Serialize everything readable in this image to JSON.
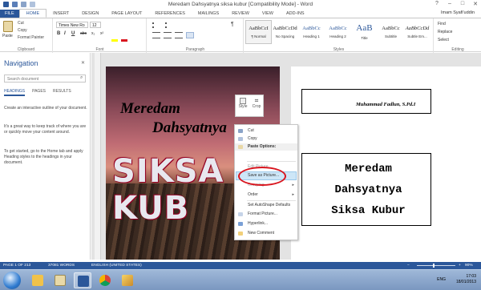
{
  "window": {
    "title": "Meredam Dahsyatnya siksa kubur [Compatibility Mode] - Word",
    "controls": [
      "?",
      "–",
      "□",
      "✕"
    ]
  },
  "ribbon_tabs": [
    "FILE",
    "HOME",
    "INSERT",
    "DESIGN",
    "PAGE LAYOUT",
    "REFERENCES",
    "MAILINGS",
    "REVIEW",
    "VIEW",
    "ADD-INS"
  ],
  "user": "Imam Syafi'uddin",
  "clipboard": {
    "paste": "Paste",
    "cut": "Cut",
    "copy": "Copy",
    "format_painter": "Format Painter",
    "label": "Clipboard"
  },
  "font": {
    "name": "Times New Ro",
    "size": "12",
    "label": "Font",
    "buttons": [
      "B",
      "I",
      "U",
      "abc",
      "x₂",
      "x²"
    ]
  },
  "paragraph": {
    "label": "Paragraph"
  },
  "styles": {
    "label": "Styles",
    "items": [
      {
        "sample": "AaBbCcI",
        "name": "¶ Normal"
      },
      {
        "sample": "AaBbCcDd",
        "name": "No Spacing"
      },
      {
        "sample": "AaBbCc",
        "name": "Heading 1"
      },
      {
        "sample": "AaBbCc",
        "name": "Heading 2"
      },
      {
        "sample": "AaB",
        "name": "Title"
      },
      {
        "sample": "AaBbCc",
        "name": "Subtitle"
      },
      {
        "sample": "AaBbCcDd",
        "name": "Subtle Em..."
      }
    ]
  },
  "editing": {
    "label": "Editing",
    "find": "Find",
    "replace": "Replace",
    "select": "Select"
  },
  "navigation": {
    "title": "Navigation",
    "close": "✕",
    "search_placeholder": "Search document",
    "tabs": [
      "HEADINGS",
      "PAGES",
      "RESULTS"
    ],
    "para1": "Create an interactive outline of your document.",
    "para2": "It's a great way to keep track of where you are or quickly move your content around.",
    "para3": "To get started, go to the Home tab and apply Heading styles to the headings in your document."
  },
  "document": {
    "cover_line1": "Meredam",
    "cover_line2": "Dahsyatnya",
    "cover_line3": "SIKSA KUB",
    "author": "Muhammad Fadlun, S.Pd.I",
    "title_line1": "Meredam",
    "title_line2": "Dahsyatnya",
    "title_line3": "Siksa Kubur"
  },
  "mini_toolbar": {
    "style": "Style",
    "crop": "Crop"
  },
  "context_menu": {
    "items": [
      {
        "label": "Cut",
        "state": "normal"
      },
      {
        "label": "Copy",
        "state": "normal"
      },
      {
        "label": "Paste Options:",
        "state": "header"
      },
      {
        "label": "Edit Picture",
        "state": "disabled"
      },
      {
        "label": "Save as Picture...",
        "state": "highlighted"
      },
      {
        "label": "Grouping",
        "state": "disabled"
      },
      {
        "label": "Order",
        "state": "normal"
      },
      {
        "label": "Set AutoShape Defaults",
        "state": "normal"
      },
      {
        "label": "Format Picture...",
        "state": "normal"
      },
      {
        "label": "Hyperlink...",
        "state": "normal"
      },
      {
        "label": "New Comment",
        "state": "normal"
      }
    ]
  },
  "status_bar": {
    "page": "PAGE 1 OF 213",
    "words": "37081 WORDS",
    "language": "ENGLISH (UNITED STATES)",
    "zoom": "90%"
  },
  "taskbar": {
    "apps": [
      "start",
      "explorer",
      "folder",
      "word",
      "chrome",
      "pencil-tool"
    ],
    "language": "ENG",
    "time": "17:03",
    "date": "18/01/2013"
  },
  "colors": {
    "accent": "#2b579a",
    "highlight_oval": "#d9161f"
  }
}
